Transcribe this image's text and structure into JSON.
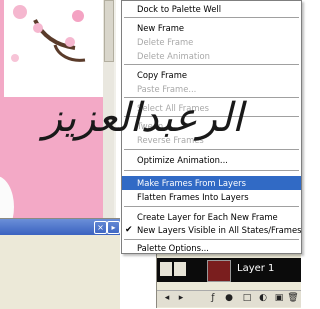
{
  "menu": {
    "items": [
      {
        "label": "Dock to Palette Well",
        "disabled": false
      },
      {
        "label": "New Frame",
        "disabled": false
      },
      {
        "label": "Delete Frame",
        "disabled": true
      },
      {
        "label": "Delete Animation",
        "disabled": true
      },
      {
        "label": "Copy Frame",
        "disabled": false
      },
      {
        "label": "Paste Frame...",
        "disabled": true
      },
      {
        "label": "Select All Frames",
        "disabled": true
      },
      {
        "label": "Tween...",
        "disabled": true
      },
      {
        "label": "Reverse Frames",
        "disabled": true
      },
      {
        "label": "Optimize Animation...",
        "disabled": false
      },
      {
        "label": "Make Frames From Layers",
        "disabled": false,
        "highlighted": true
      },
      {
        "label": "Flatten Frames Into Layers",
        "disabled": false
      },
      {
        "label": "Create Layer for Each New Frame",
        "disabled": false
      },
      {
        "label": "New Layers Visible in All States/Frames",
        "disabled": false,
        "checked": true
      },
      {
        "label": "Palette Options...",
        "disabled": false
      }
    ]
  },
  "layers": {
    "row_name": "Layer 1"
  },
  "signature_text": "الرعبدالعزيز",
  "colors": {
    "highlight": "#316ac5",
    "canvas_pink": "#f3a9c6",
    "menu_bg": "#ffffff"
  }
}
